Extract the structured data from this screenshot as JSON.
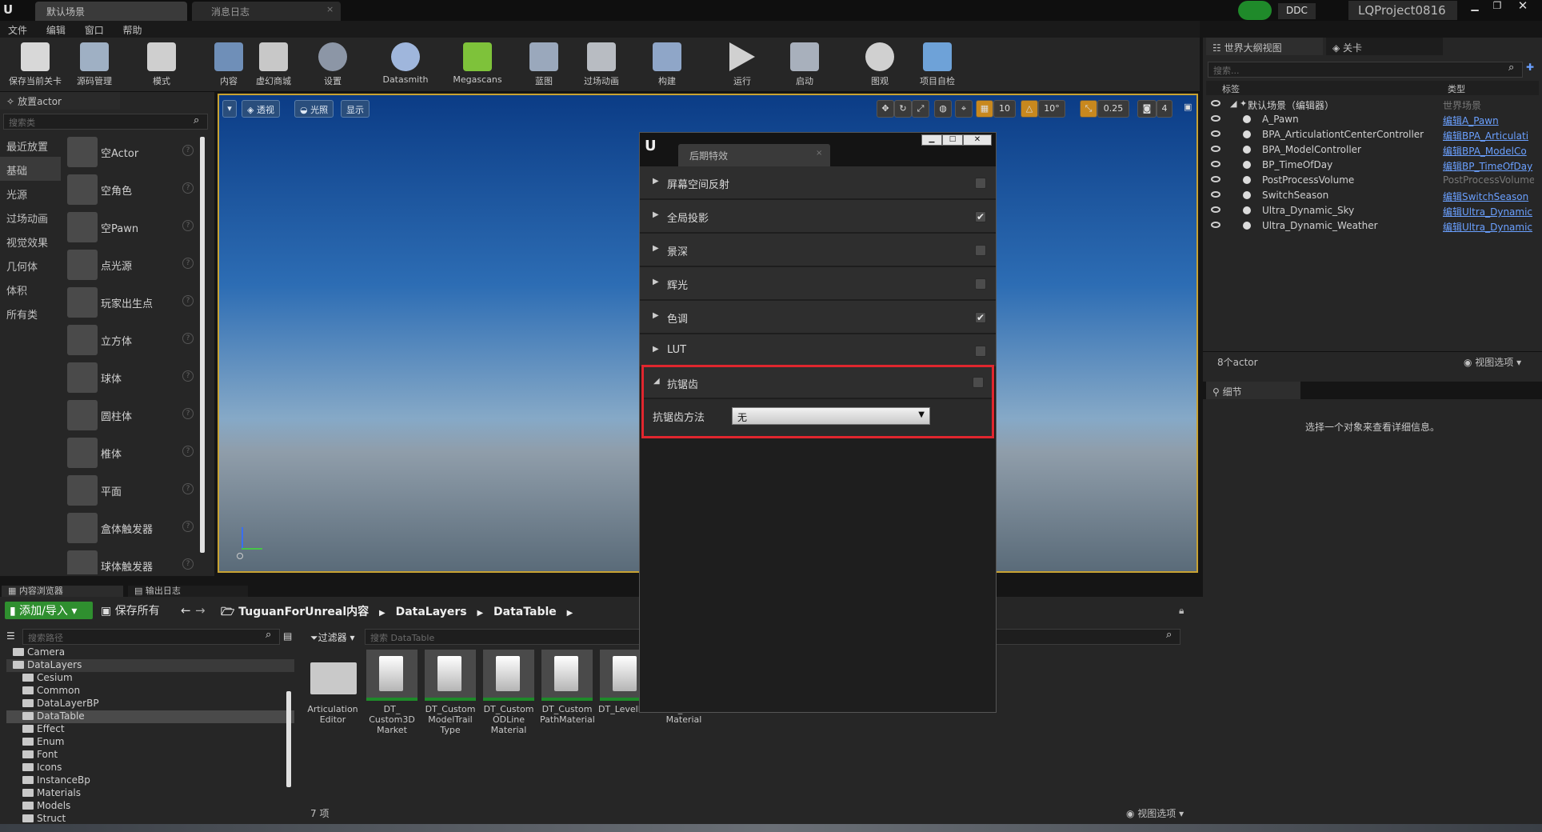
{
  "titlebar": {
    "tabs": [
      "默认场景",
      "消息日志"
    ],
    "ddc": "DDC",
    "project": "LQProject0816"
  },
  "menu": [
    "文件",
    "编辑",
    "窗口",
    "帮助"
  ],
  "toolbar": [
    "保存当前关卡",
    "源码管理",
    "模式",
    "内容",
    "虚幻商城",
    "设置",
    "Datasmith",
    "Megascans",
    "蓝图",
    "过场动画",
    "构建",
    "运行",
    "启动",
    "图观",
    "项目自检"
  ],
  "place_panel": {
    "title": "放置actor",
    "search_placeholder": "搜索类",
    "categories": [
      "最近放置",
      "基础",
      "光源",
      "过场动画",
      "视觉效果",
      "几何体",
      "体积",
      "所有类"
    ],
    "items": [
      "空Actor",
      "空角色",
      "空Pawn",
      "点光源",
      "玩家出生点",
      "立方体",
      "球体",
      "圆柱体",
      "椎体",
      "平面",
      "盒体触发器",
      "球体触发器"
    ]
  },
  "viewport": {
    "buttons": [
      "透视",
      "光照",
      "显示"
    ],
    "grid_snap": "10",
    "rot_snap": "10°",
    "scale_snap": "0.25",
    "cam_speed": "4"
  },
  "dialog": {
    "tab": "后期特效",
    "rows": [
      {
        "label": "屏幕空间反射",
        "checked": false
      },
      {
        "label": "全局投影",
        "checked": true
      },
      {
        "label": "景深",
        "checked": false
      },
      {
        "label": "辉光",
        "checked": false
      },
      {
        "label": "色调",
        "checked": true
      },
      {
        "label": "LUT",
        "checked": false
      }
    ],
    "expanded": {
      "label": "抗锯齿",
      "checked": false,
      "method_label": "抗锯齿方法",
      "method_value": "无"
    }
  },
  "content_browser": {
    "tabs": [
      "内容浏览器",
      "输出日志"
    ],
    "add_import": "添加/导入",
    "save_all": "保存所有",
    "path": [
      "TuguanForUnreal内容",
      "DataLayers",
      "DataTable"
    ],
    "path_search_placeholder": "搜索路径",
    "filter": "过滤器",
    "asset_search_placeholder": "搜索 DataTable",
    "folders": [
      {
        "name": "Camera",
        "level": 1
      },
      {
        "name": "DataLayers",
        "level": 1
      },
      {
        "name": "Cesium",
        "level": 2
      },
      {
        "name": "Common",
        "level": 2
      },
      {
        "name": "DataLayerBP",
        "level": 2
      },
      {
        "name": "DataTable",
        "level": 2
      },
      {
        "name": "Effect",
        "level": 2
      },
      {
        "name": "Enum",
        "level": 2
      },
      {
        "name": "Font",
        "level": 2
      },
      {
        "name": "Icons",
        "level": 2
      },
      {
        "name": "InstanceBp",
        "level": 2
      },
      {
        "name": "Materials",
        "level": 2
      },
      {
        "name": "Models",
        "level": 2
      },
      {
        "name": "Struct",
        "level": 2
      }
    ],
    "assets": [
      {
        "name": "Articulation Editor",
        "type": "folder"
      },
      {
        "name": "DT_ Custom3D Market",
        "type": "table"
      },
      {
        "name": "DT_Custom ModelTrail Type",
        "type": "table"
      },
      {
        "name": "DT_Custom ODLine Material",
        "type": "table"
      },
      {
        "name": "DT_Custom PathMaterial",
        "type": "table"
      },
      {
        "name": "DT_LevelData",
        "type": "table"
      },
      {
        "name": "DT_Path Material",
        "type": "table"
      }
    ],
    "count": "7 项",
    "view_options": "视图选项"
  },
  "outliner": {
    "tabs": [
      "世界大纲视图",
      "关卡"
    ],
    "search_placeholder": "搜索...",
    "col_label": "标签",
    "col_type": "类型",
    "root": {
      "name": "默认场景（编辑器）",
      "type": "世界场景"
    },
    "rows": [
      {
        "name": "A_Pawn",
        "type": "编辑A_Pawn",
        "link": true
      },
      {
        "name": "BPA_ArticulationtCenterController",
        "type": "编辑BPA_Articulati",
        "link": true
      },
      {
        "name": "BPA_ModelController",
        "type": "编辑BPA_ModelCo",
        "link": true
      },
      {
        "name": "BP_TimeOfDay",
        "type": "编辑BP_TimeOfDay",
        "link": true
      },
      {
        "name": "PostProcessVolume",
        "type": "PostProcessVolume",
        "link": false
      },
      {
        "name": "SwitchSeason",
        "type": "编辑SwitchSeason",
        "link": true
      },
      {
        "name": "Ultra_Dynamic_Sky",
        "type": "编辑Ultra_Dynamic",
        "link": true
      },
      {
        "name": "Ultra_Dynamic_Weather",
        "type": "编辑Ultra_Dynamic",
        "link": true
      }
    ],
    "count": "8个actor",
    "view_options": "视图选项"
  },
  "details": {
    "tab": "细节",
    "empty_text": "选择一个对象来查看详细信息。"
  }
}
